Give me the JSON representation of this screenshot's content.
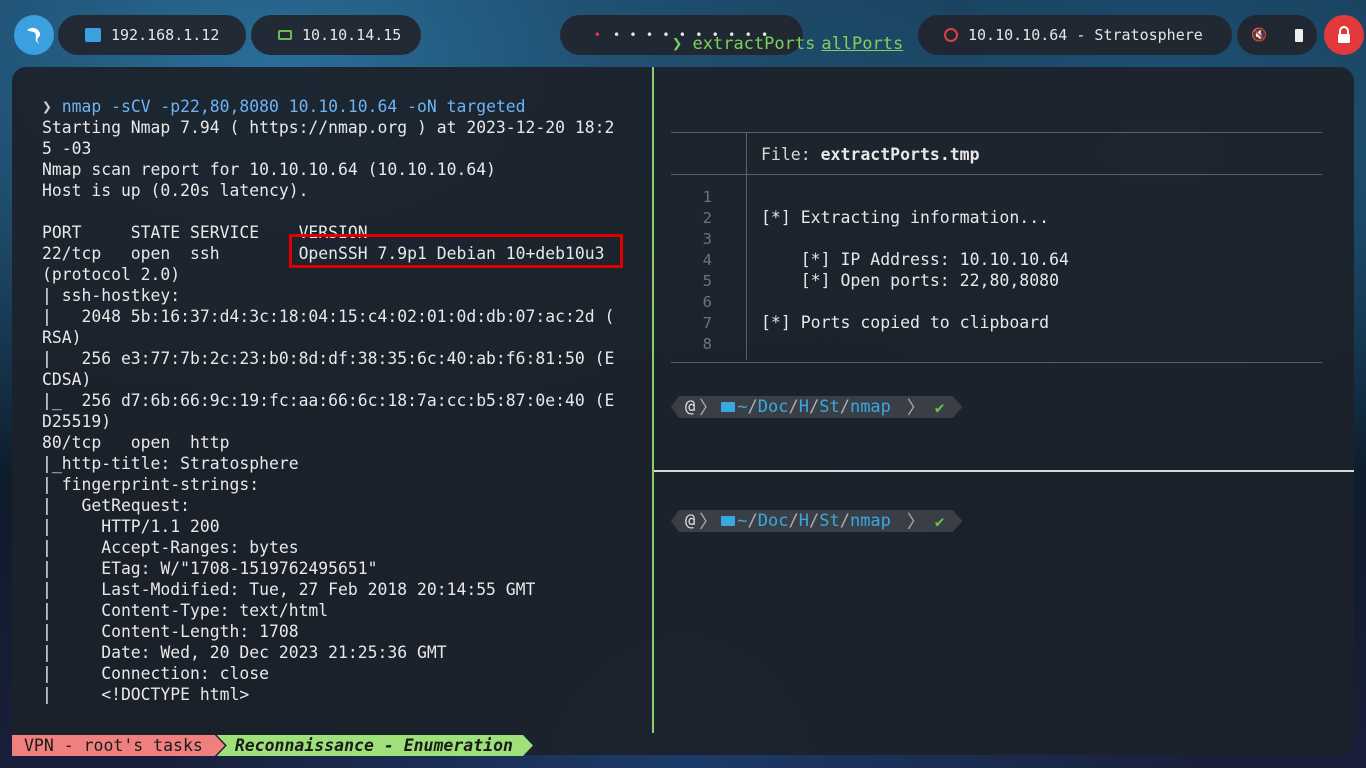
{
  "topbar": {
    "ip_local": "192.168.1.12",
    "ip_vpn": "10.10.14.15",
    "target": "10.10.10.64 - Stratosphere",
    "workspace_dots": "•  •  •  •  •  •  •  •  •  •"
  },
  "left_terminal": {
    "prompt_arrow": "❯",
    "command": "nmap -sCV -p22,80,8080 10.10.10.64 -oN targeted",
    "output": "Starting Nmap 7.94 ( https://nmap.org ) at 2023-12-20 18:2\n5 -03\nNmap scan report for 10.10.10.64 (10.10.10.64)\nHost is up (0.20s latency).\n\nPORT     STATE SERVICE    VERSION\n22/tcp   open  ssh        OpenSSH 7.9p1 Debian 10+deb10u3\n(protocol 2.0)\n| ssh-hostkey:\n|   2048 5b:16:37:d4:3c:18:04:15:c4:02:01:0d:db:07:ac:2d (\nRSA)\n|   256 e3:77:7b:2c:23:b0:8d:df:38:35:6c:40:ab:f6:81:50 (E\nCDSA)\n|_  256 d7:6b:66:9c:19:fc:aa:66:6c:18:7a:cc:b5:87:0e:40 (E\nD25519)\n80/tcp   open  http\n|_http-title: Stratosphere\n| fingerprint-strings:\n|   GetRequest:\n|     HTTP/1.1 200\n|     Accept-Ranges: bytes\n|     ETag: W/\"1708-1519762495651\"\n|     Last-Modified: Tue, 27 Feb 2018 20:14:55 GMT\n|     Content-Type: text/html\n|     Content-Length: 1708\n|     Date: Wed, 20 Dec 2023 21:25:36 GMT\n|     Connection: close\n|     <!DOCTYPE html>"
  },
  "right_top": {
    "prompt_arrow": "❯",
    "command": "extractPorts",
    "argument": "allPorts",
    "file_label": "File:",
    "file_name": "extractPorts.tmp",
    "line_numbers": "1\n2\n3\n4\n5\n6\n7\n8",
    "content": "[*] Extracting information...\n\n    [*] IP Address: 10.10.10.64\n    [*] Open ports: 22,80,8080\n\n[*] Ports copied to clipboard"
  },
  "prompt": {
    "path_prefix": "~",
    "path_parts": [
      "Doc",
      "H",
      "St",
      "nmap"
    ],
    "status_ok": "✔"
  },
  "statusbar": {
    "session": "VPN - root's tasks",
    "window": "Reconnaissance - Enumeration"
  },
  "colors": {
    "accent_green": "#8ad16b",
    "highlight_red": "#e00000",
    "path_blue": "#39a9e0"
  }
}
